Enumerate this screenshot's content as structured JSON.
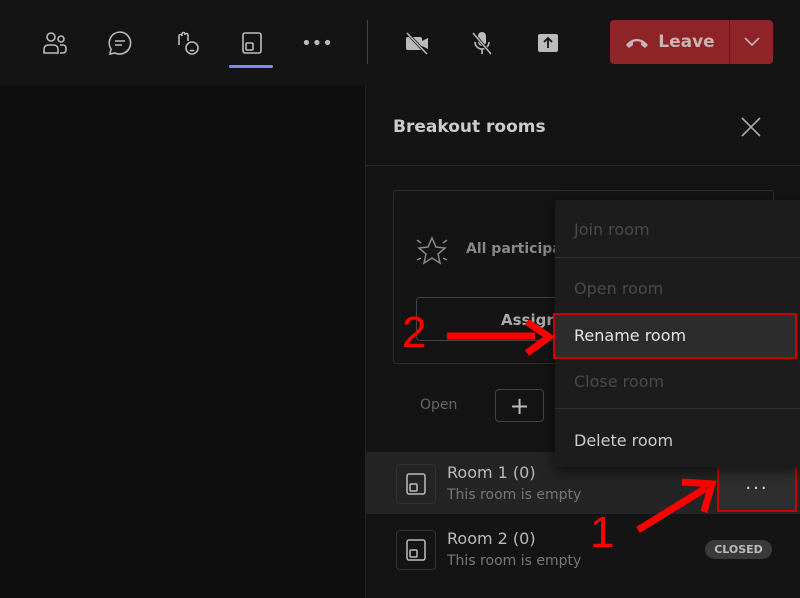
{
  "toolbar": {
    "items": [
      {
        "icon": "people-icon"
      },
      {
        "icon": "chat-icon"
      },
      {
        "icon": "reactions-icon"
      },
      {
        "icon": "breakout-rooms-icon",
        "active": true
      },
      {
        "icon": "more-icon"
      },
      {
        "icon": "camera-off-icon"
      },
      {
        "icon": "mic-off-icon"
      },
      {
        "icon": "share-icon"
      }
    ],
    "leave_label": "Leave",
    "leave_color": "#a4262c",
    "active_color": "#7f85f5"
  },
  "panel": {
    "title": "Breakout rooms",
    "all_participants": "All participa",
    "assign_label": "Assign",
    "open_label": "Open",
    "add_label": "+"
  },
  "menu": {
    "items": [
      {
        "label": "Join room",
        "enabled": false
      },
      {
        "label": "Open room",
        "enabled": false
      },
      {
        "label": "Rename room",
        "enabled": true
      },
      {
        "label": "Close room",
        "enabled": false
      },
      {
        "label": "Delete room",
        "enabled": true
      }
    ]
  },
  "rooms": [
    {
      "name": "Room 1  (0)",
      "status": "This room is empty",
      "more": "···"
    },
    {
      "name": "Room 2  (0)",
      "status": "This room is empty",
      "badge": "CLOSED"
    }
  ],
  "annotations": {
    "step1": "1",
    "step2": "2",
    "color": "#ff0000"
  }
}
